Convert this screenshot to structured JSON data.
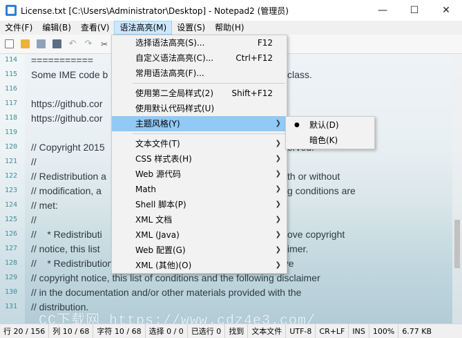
{
  "window": {
    "title": "License.txt [C:\\Users\\Administrator\\Desktop] - Notepad2 (管理员)",
    "minimize": "—",
    "maximize": "☐",
    "close": "✕"
  },
  "menubar": [
    "文件(F)",
    "编辑(B)",
    "查看(V)",
    "语法高亮(M)",
    "设置(S)",
    "帮助(H)"
  ],
  "editor": {
    "lines": [
      {
        "n": "114",
        "text": "===========",
        "after": ""
      },
      {
        "n": "115",
        "text": "Some IME code b",
        "after": "class."
      },
      {
        "n": "116",
        "text": "",
        "after": ""
      },
      {
        "n": "117",
        "text": "https://github.cor",
        "after": ""
      },
      {
        "n": "118",
        "text": "https://github.cor",
        "after": ""
      },
      {
        "n": "119",
        "text": "",
        "after": ""
      },
      {
        "n": "120",
        "text": "// Copyright 2015",
        "after": "erved."
      },
      {
        "n": "121",
        "text": "//",
        "after": ""
      },
      {
        "n": "122",
        "text": "// Redistribution a",
        "after": "th or without"
      },
      {
        "n": "123",
        "text": "// modification, a",
        "after": "g conditions are"
      },
      {
        "n": "124",
        "text": "// met:",
        "after": ""
      },
      {
        "n": "125",
        "text": "//",
        "after": ""
      },
      {
        "n": "126",
        "text": "//    * Redistributi",
        "after": "ove copyright"
      },
      {
        "n": "127",
        "text": "// notice, this list",
        "after": "imer."
      },
      {
        "n": "128",
        "text": "//    * Redistributions in binary form must reproduce the above",
        "after": ""
      },
      {
        "n": "129",
        "text": "// copyright notice, this list of conditions and the following disclaimer",
        "after": ""
      },
      {
        "n": "130",
        "text": "// in the documentation and/or other materials provided with the",
        "after": ""
      },
      {
        "n": "131",
        "text": "// distribution.",
        "after": ""
      }
    ],
    "watermark": "CC下载网 https://www.cdz4e3.com/"
  },
  "statusbar": [
    "行 20 / 156",
    "列 10 / 68",
    "字符 10 / 68",
    "选择 0 / 0",
    "已选行 0",
    "找到",
    "文本文件",
    "UTF-8",
    "CR+LF",
    "INS",
    "100%",
    "6.77 KB"
  ],
  "syntax_menu": {
    "items": [
      {
        "label": "选择语法高亮(S)...",
        "shortcut": "F12"
      },
      {
        "label": "自定义语法高亮(C)...",
        "shortcut": "Ctrl+F12"
      },
      {
        "label": "常用语法高亮(F)...",
        "shortcut": ""
      },
      {
        "sep": true
      },
      {
        "label": "使用第二全局样式(2)",
        "shortcut": "Shift+F12"
      },
      {
        "label": "使用默认代码样式(U)",
        "shortcut": ""
      },
      {
        "label": "主题风格(Y)",
        "submenu": true,
        "highlight": true
      },
      {
        "sep": true
      },
      {
        "label": "文本文件(T)",
        "submenu": true
      },
      {
        "label": "CSS 样式表(H)",
        "submenu": true
      },
      {
        "label": "Web 源代码",
        "submenu": true
      },
      {
        "label": "Math",
        "submenu": true
      },
      {
        "label": "Shell 脚本(P)",
        "submenu": true
      },
      {
        "label": "XML 文档",
        "submenu": true
      },
      {
        "label": "XML (Java)",
        "submenu": true
      },
      {
        "label": "Web 配置(G)",
        "submenu": true
      },
      {
        "label": "XML (其他)(O)",
        "submenu": true
      }
    ]
  },
  "theme_submenu": {
    "items": [
      {
        "label": "默认(D)",
        "checked": true
      },
      {
        "label": "暗色(K)",
        "checked": false
      }
    ]
  }
}
